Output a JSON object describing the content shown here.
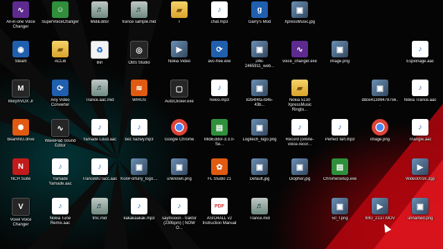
{
  "desktop": {
    "icons": [
      {
        "label": "All-in-one Voice Changer",
        "icon": "voice-wave-icon"
      },
      {
        "label": "SuperVoiceChanger",
        "icon": "voice-app-icon"
      },
      {
        "label": "MidiEditor",
        "icon": "midi-editor-icon"
      },
      {
        "label": "trance sample.mid",
        "icon": "midi-file-icon"
      },
      {
        "label": "T",
        "icon": "folder-icon"
      },
      {
        "label": "chat.mp3",
        "icon": "audio-file-icon"
      },
      {
        "label": "Garry's Mod",
        "icon": "game-icon"
      },
      {
        "label": "XpressMusic.jpg",
        "icon": "image-file-icon"
      },
      {
        "label": "Steam",
        "icon": "steam-icon"
      },
      {
        "label": "ACLib",
        "icon": "folder-icon"
      },
      {
        "label": "Bin",
        "icon": "recycle-bin-icon"
      },
      {
        "label": "OBS Studio",
        "icon": "obs-icon"
      },
      {
        "label": "Nokia Video",
        "icon": "video-file-icon"
      },
      {
        "label": "avc-free.exe",
        "icon": "converter-icon"
      },
      {
        "label": "246-2465911_web...",
        "icon": "image-file-icon"
      },
      {
        "label": "voice_changer.exe",
        "icon": "voice-wave-icon"
      },
      {
        "label": "image.png",
        "icon": "image-file-icon"
      },
      {
        "label": "Espionage.aac",
        "icon": "audio-file-icon"
      },
      {
        "label": "MorphVOX Jr",
        "icon": "morphvox-icon"
      },
      {
        "label": "Any Video Converter",
        "icon": "converter-icon"
      },
      {
        "label": "Trance.aac.mid",
        "icon": "midi-file-icon"
      },
      {
        "label": "WIRUS",
        "icon": "wifi-app-icon"
      },
      {
        "label": "AutoClicker.exe",
        "icon": "mouse-icon"
      },
      {
        "label": "heloo.mp3",
        "icon": "audio-file-icon"
      },
      {
        "label": "82b4f4fa-fd45-43b...",
        "icon": "image-file-icon"
      },
      {
        "label": "Nokia 5130 XpressMusic Ringto...",
        "icon": "folder-icon"
      },
      {
        "label": "ddce41399479756...",
        "icon": "image-file-icon"
      },
      {
        "label": "Nokia Trance.aac",
        "icon": "audio-file-icon"
      },
      {
        "label": "BeamNG.drive",
        "icon": "beamng-icon"
      },
      {
        "label": "WavePad Sound Editor",
        "icon": "wavepad-icon"
      },
      {
        "label": "Yamade Loud.aac",
        "icon": "audio-file-icon"
      },
      {
        "label": "bez nazwy.mp3",
        "icon": "audio-file-icon"
      },
      {
        "label": "Google Chrome",
        "icon": "chrome-icon"
      },
      {
        "label": "MidiEditor-3.3.0-Se...",
        "icon": "installer-icon"
      },
      {
        "label": "Logitech_logo.png",
        "icon": "image-file-icon"
      },
      {
        "label": "Record (online-voice-recor...",
        "icon": "audio-file-icon"
      },
      {
        "label": "Perfect fart.mp3",
        "icon": "audio-file-icon"
      },
      {
        "label": "image.png",
        "icon": "chrome-icon"
      },
      {
        "label": "Triangle.aac",
        "icon": "audio-file-icon"
      },
      {
        "label": "NCH Suite",
        "icon": "nch-icon"
      },
      {
        "label": "Yamade Yamade.aac",
        "icon": "audio-file-icon"
      },
      {
        "label": "TranceBUTacc.aac",
        "icon": "audio-file-icon"
      },
      {
        "label": "KoloFortuny_logo....",
        "icon": "image-file-icon"
      },
      {
        "label": "unknown.png",
        "icon": "image-file-icon"
      },
      {
        "label": "FL Studio 21",
        "icon": "fl-studio-icon"
      },
      {
        "label": "Default.jpg",
        "icon": "image-file-icon"
      },
      {
        "label": "Diopher.jpg",
        "icon": "image-file-icon"
      },
      {
        "label": "ChromeSetup.exe",
        "icon": "installer-icon"
      },
      {
        "label": "Wideo0016.3gp",
        "icon": "video-file-icon"
      },
      {
        "label": "Voxel Voice Changer",
        "icon": "voxal-icon"
      },
      {
        "label": "Nokia Tune Remix.aac",
        "icon": "audio-file-icon"
      },
      {
        "label": "tmc.mid",
        "icon": "midi-file-icon"
      },
      {
        "label": "kakakaakak.mp3",
        "icon": "audio-file-icon"
      },
      {
        "label": "saymooon - traktor (230bpm) ( NOW O...",
        "icon": "audio-file-icon"
      },
      {
        "label": "ASIO4ALL v2 Instruction Manual",
        "icon": "pdf-icon"
      },
      {
        "label": "Trance.mid",
        "icon": "midi-file-icon"
      },
      {
        "label": "50_f.png",
        "icon": "image-file-icon"
      },
      {
        "label": "IMG_2137.MOV",
        "icon": "video-file-icon"
      },
      {
        "label": "unnamed.png",
        "icon": "image-file-icon"
      }
    ]
  }
}
